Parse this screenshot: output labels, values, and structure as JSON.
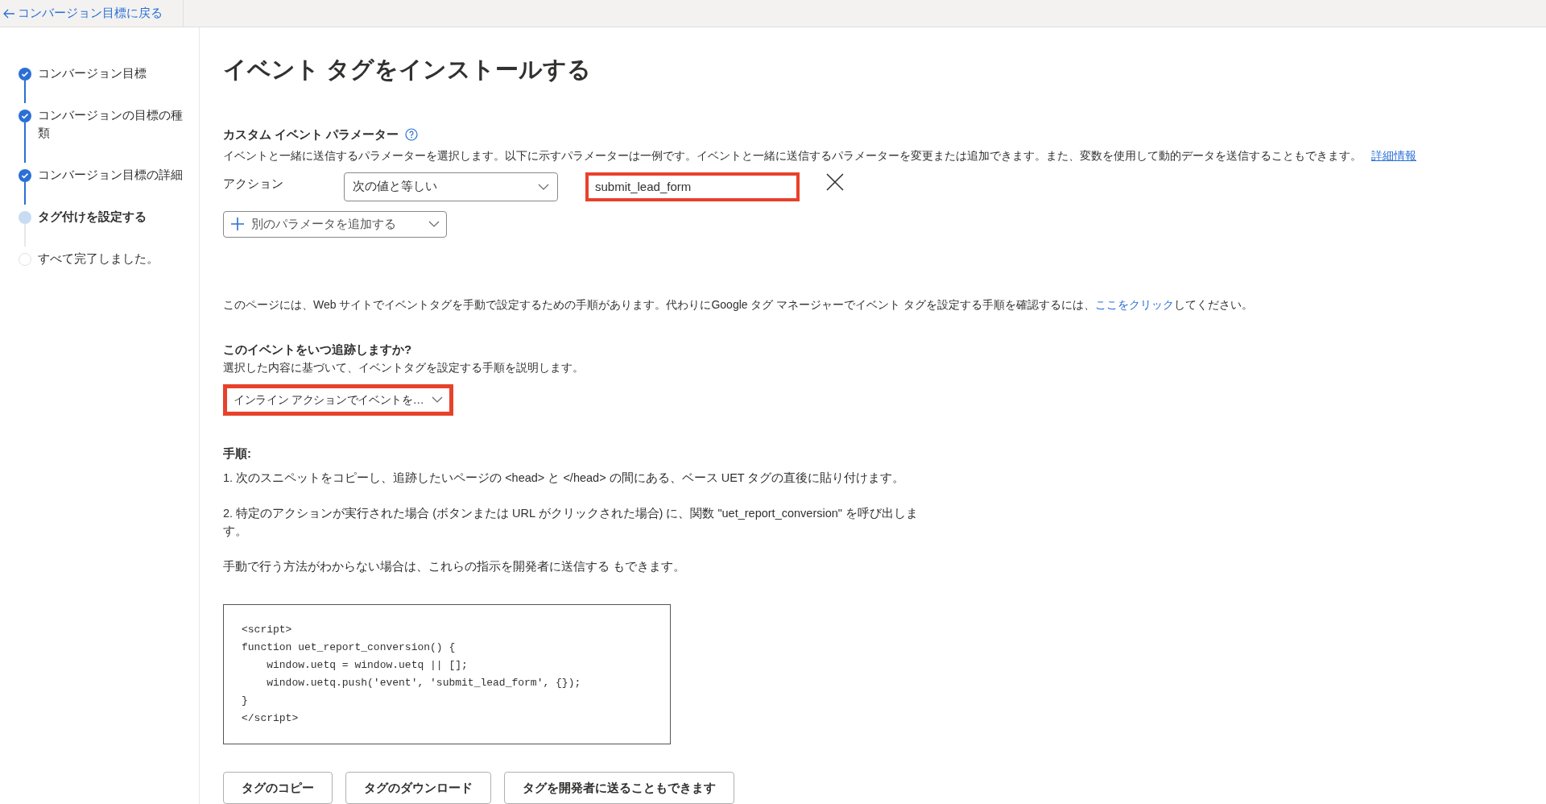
{
  "back_link": "コンバージョン目標に戻る",
  "steps": [
    {
      "label": "コンバージョン目標",
      "kind": "done"
    },
    {
      "label": "コンバージョンの目標の種類",
      "kind": "done"
    },
    {
      "label": "コンバージョン目標の詳細",
      "kind": "done"
    },
    {
      "label": "タグ付けを設定する",
      "kind": "current"
    },
    {
      "label": "すべて完了しました。",
      "kind": "pending"
    }
  ],
  "title": "イベント タグをインストールする",
  "custom_params": {
    "heading": "カスタム イベント パラメーター",
    "description": "イベントと一緒に送信するパラメーターを選択します。以下に示すパラメーターは一例です。イベントと一緒に送信するパラメーターを変更または追加できます。また、変数を使用して動的データを送信することもできます。",
    "learn_more": "詳細情報",
    "rows": [
      {
        "label": "アクション",
        "operator": "次の値と等しい",
        "value": "submit_lead_form",
        "highlighted": true
      }
    ],
    "add_button": "別のパラメータを追加する"
  },
  "manual_note": {
    "before": "このページには、Web サイトでイベントタグを手動で設定するための手順があります。代わりにGoogle タグ マネージャーでイベント タグを設定する手順を確認するには、",
    "link": "ここをクリック",
    "after": "してください。"
  },
  "when": {
    "question": "このイベントをいつ追跡しますか?",
    "hint": "選択した内容に基づいて、イベントタグを設定する手順を説明します。",
    "dropdown": "インライン アクションでイベントを…",
    "highlighted": true
  },
  "instructions": {
    "heading": "手順:",
    "paragraphs": [
      "1. 次のスニペットをコピーし、追跡したいページの <head> と </head> の間にある、ベース UET タグの直後に貼り付けます。",
      "2. 特定のアクションが実行された場合 (ボタンまたは URL がクリックされた場合) に、関数 \"uet_report_conversion\" を呼び出します。",
      "手動で行う方法がわからない場合は、これらの指示を開発者に送信する もできます。"
    ]
  },
  "code": "<script>\nfunction uet_report_conversion() {\n    window.uetq = window.uetq || [];\n    window.uetq.push('event', 'submit_lead_form', {});\n}\n</script>",
  "buttons": [
    "タグのコピー",
    "タグのダウンロード",
    "タグを開発者に送ることもできます"
  ]
}
